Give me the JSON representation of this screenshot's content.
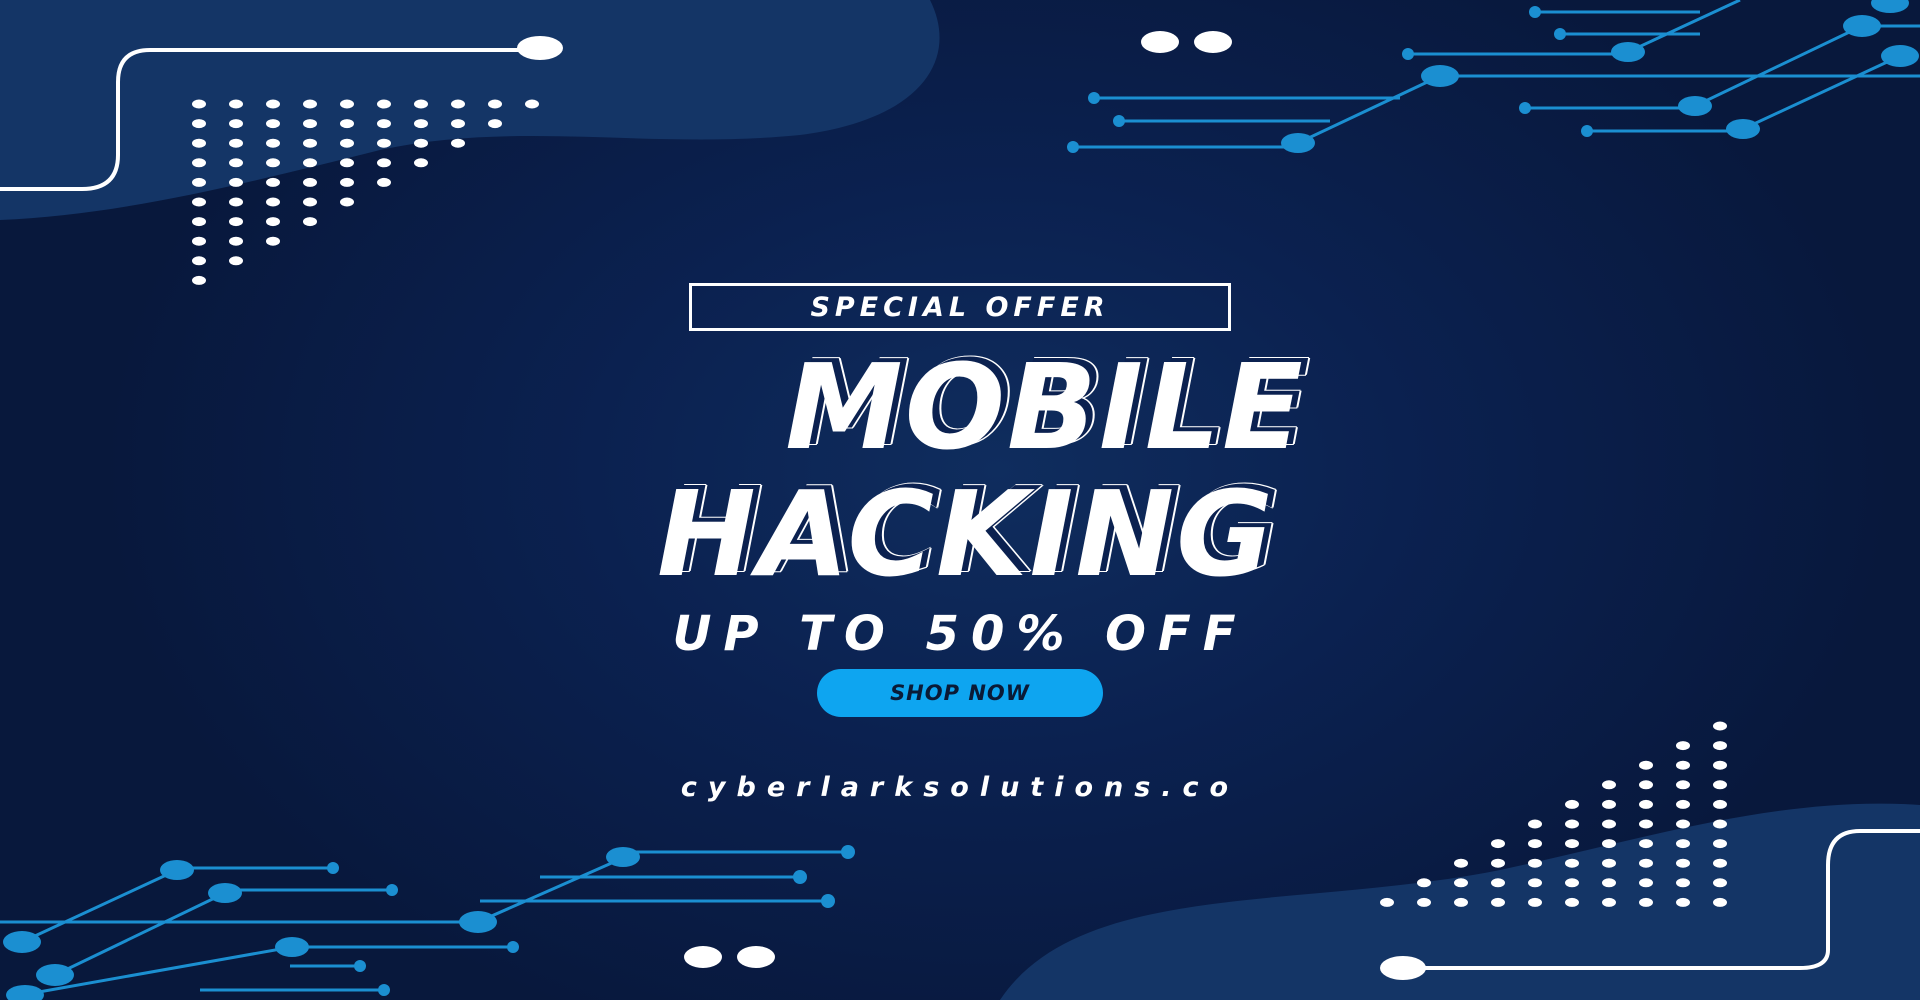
{
  "banner": {
    "label": "SPECIAL OFFER"
  },
  "headline": {
    "line1": "MOBILE",
    "line2": "HACKING"
  },
  "offer": {
    "text": "UP TO 50% OFF"
  },
  "cta": {
    "label": "SHOP NOW"
  },
  "footer": {
    "website": "cyberlarksolutions.co"
  },
  "colors": {
    "background": "#08183c",
    "blob": "#143566",
    "accent": "#0ea5f0",
    "circuit": "#1b8fd1",
    "text": "#ffffff"
  }
}
